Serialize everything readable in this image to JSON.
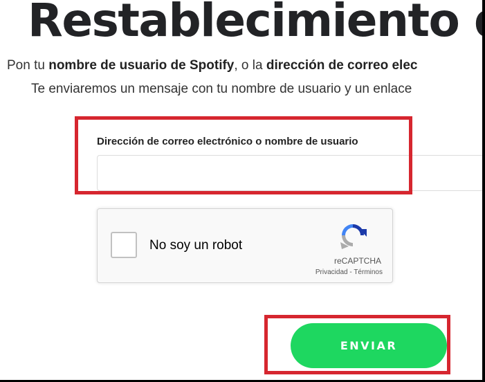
{
  "page": {
    "title": "Restablecimiento de c"
  },
  "intro": {
    "line1": {
      "part1": "Pon tu ",
      "bold1": "nombre de usuario de Spotify",
      "part2": ", o la ",
      "bold2": "dirección de correo elec"
    },
    "line2": "Te enviaremos un mensaje con tu nombre de usuario y un enlace"
  },
  "form": {
    "field_label": "Dirección de correo electrónico o nombre de usuario",
    "field_value": "",
    "submit_label": "ENVIAR"
  },
  "recaptcha": {
    "label": "No soy un robot",
    "brand": "reCAPTCHA",
    "privacy": "Privacidad",
    "separator": " - ",
    "terms": "Términos"
  },
  "colors": {
    "button_green": "#1ed760",
    "highlight_red": "#d6262f",
    "title_text": "#222326"
  }
}
